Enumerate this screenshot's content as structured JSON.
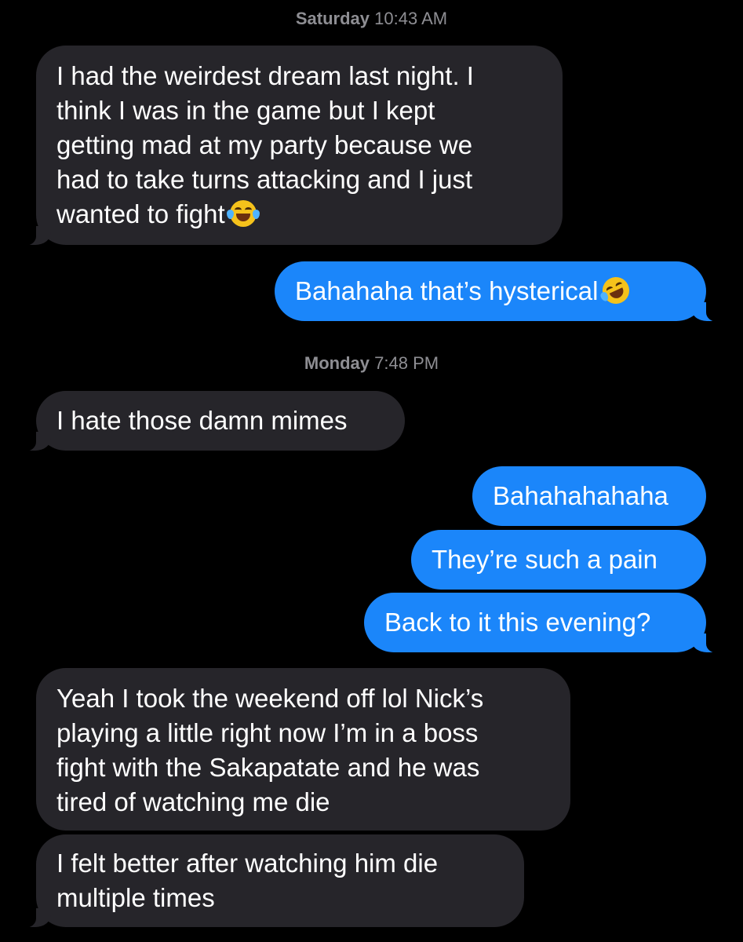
{
  "conversation": {
    "timestamps": [
      {
        "day": "Saturday",
        "time": "10:43 AM"
      },
      {
        "day": "Monday",
        "time": "7:48 PM"
      }
    ],
    "messages": [
      {
        "direction": "received",
        "lines": [
          "I had the weirdest dream last night. I",
          "think I was in the game but I kept",
          "getting mad at my party because we",
          "had to take turns attacking and I just",
          "wanted to fight"
        ],
        "emoji": "face-with-tears-of-joy-icon"
      },
      {
        "direction": "sent",
        "lines": [
          "Bahahaha that’s hysterical"
        ],
        "emoji": "rolling-on-floor-laughing-icon"
      },
      {
        "direction": "received",
        "lines": [
          "I hate those damn mimes"
        ]
      },
      {
        "direction": "sent",
        "lines": [
          "Bahahahahaha"
        ]
      },
      {
        "direction": "sent",
        "lines": [
          "They’re such a pain"
        ]
      },
      {
        "direction": "sent",
        "lines": [
          "Back to it this evening?"
        ]
      },
      {
        "direction": "received",
        "lines": [
          "Yeah I took the weekend off lol Nick’s",
          "playing a little right now I’m in a boss",
          "fight with the Sakapatate and he was",
          "tired of watching me die"
        ]
      },
      {
        "direction": "received",
        "lines": [
          "I felt better after watching him die",
          "multiple times"
        ]
      }
    ]
  },
  "colors": {
    "background": "#000000",
    "received_bubble": "#26252a",
    "sent_bubble": "#1b86fa",
    "timestamp_text": "#8e8e93"
  }
}
